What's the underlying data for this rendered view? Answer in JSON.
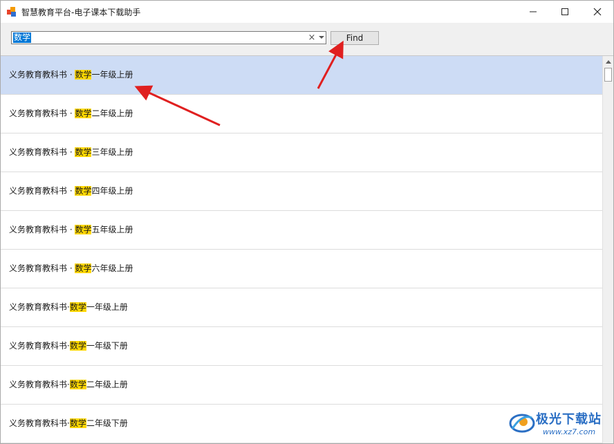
{
  "window": {
    "title": "智慧教育平台-电子课本下载助手",
    "controls": {
      "minimize": "—",
      "maximize": "☐",
      "close": "✕"
    }
  },
  "toolbar": {
    "search_value": "数学",
    "clear_glyph": "×",
    "find_label": "Find"
  },
  "list": {
    "items": [
      {
        "prefix": "义务教育教科书 · ",
        "keyword": "数学",
        "suffix": "一年级上册",
        "selected": true
      },
      {
        "prefix": "义务教育教科书 · ",
        "keyword": "数学",
        "suffix": "二年级上册",
        "selected": false
      },
      {
        "prefix": "义务教育教科书 · ",
        "keyword": "数学",
        "suffix": "三年级上册",
        "selected": false
      },
      {
        "prefix": "义务教育教科书 · ",
        "keyword": "数学",
        "suffix": "四年级上册",
        "selected": false
      },
      {
        "prefix": "义务教育教科书 · ",
        "keyword": "数学",
        "suffix": "五年级上册",
        "selected": false
      },
      {
        "prefix": "义务教育教科书 · ",
        "keyword": "数学",
        "suffix": "六年级上册",
        "selected": false
      },
      {
        "prefix": "义务教育教科书·",
        "keyword": "数学",
        "suffix": "一年级上册",
        "selected": false
      },
      {
        "prefix": "义务教育教科书·",
        "keyword": "数学",
        "suffix": "一年级下册",
        "selected": false
      },
      {
        "prefix": "义务教育教科书·",
        "keyword": "数学",
        "suffix": "二年级上册",
        "selected": false
      },
      {
        "prefix": "义务教育教科书·",
        "keyword": "数学",
        "suffix": "二年级下册",
        "selected": false
      }
    ]
  },
  "watermark": {
    "brand": "极光下载站",
    "url": "www.xz7.com"
  },
  "colors": {
    "selection": "#cddcf5",
    "highlight": "#ffd700",
    "annotation_arrow": "#e02020",
    "search_selection": "#0078d7"
  }
}
